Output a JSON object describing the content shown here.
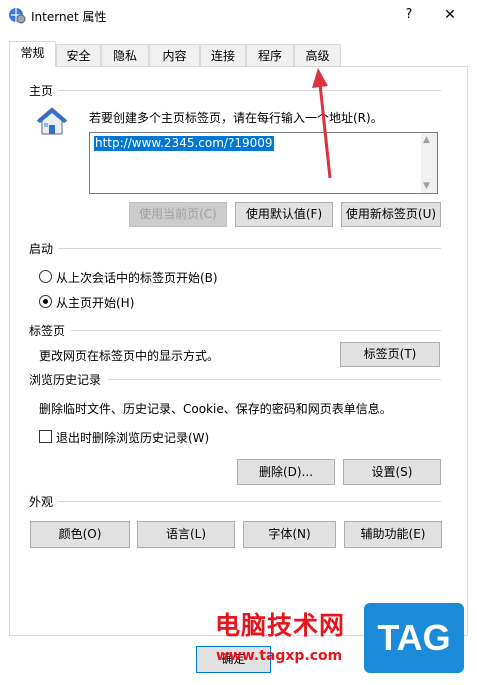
{
  "window": {
    "title": "Internet 属性",
    "help": "?",
    "close": "✕"
  },
  "tabs": [
    "常规",
    "安全",
    "隐私",
    "内容",
    "连接",
    "程序",
    "高级"
  ],
  "homepage": {
    "group_label": "主页",
    "description": "若要创建多个主页标签页，请在每行输入一个地址(R)。",
    "value": "http://www.2345.com/?19009",
    "buttons": [
      "使用当前页(C)",
      "使用默认值(F)",
      "使用新标签页(U)"
    ]
  },
  "startup": {
    "group_label": "启动",
    "options": [
      "从上次会话中的标签页开始(B)",
      "从主页开始(H)"
    ],
    "selected_index": 1
  },
  "tabs_section": {
    "group_label": "标签页",
    "description": "更改网页在标签页中的显示方式。",
    "button": "标签页(T)"
  },
  "history": {
    "group_label": "浏览历史记录",
    "description": "删除临时文件、历史记录、Cookie、保存的密码和网页表单信息。",
    "checkbox_label": "退出时删除浏览历史记录(W)",
    "checked": false,
    "buttons": [
      "删除(D)...",
      "设置(S)"
    ]
  },
  "appearance": {
    "group_label": "外观",
    "buttons": [
      "颜色(O)",
      "语言(L)",
      "字体(N)",
      "辅助功能(E)"
    ]
  },
  "footer": {
    "ok_label": "确定"
  },
  "watermark": {
    "site_name": "电脑技术网",
    "url": "www.tagxp.com",
    "logo": "TAG"
  },
  "colors": {
    "accent": "#0078d7",
    "arrow": "#d9333f",
    "watermark": "#e8141c",
    "logo_bg": "#1b8ad8"
  },
  "icons": {
    "window": "ie-settings-icon",
    "home": "house-icon"
  }
}
